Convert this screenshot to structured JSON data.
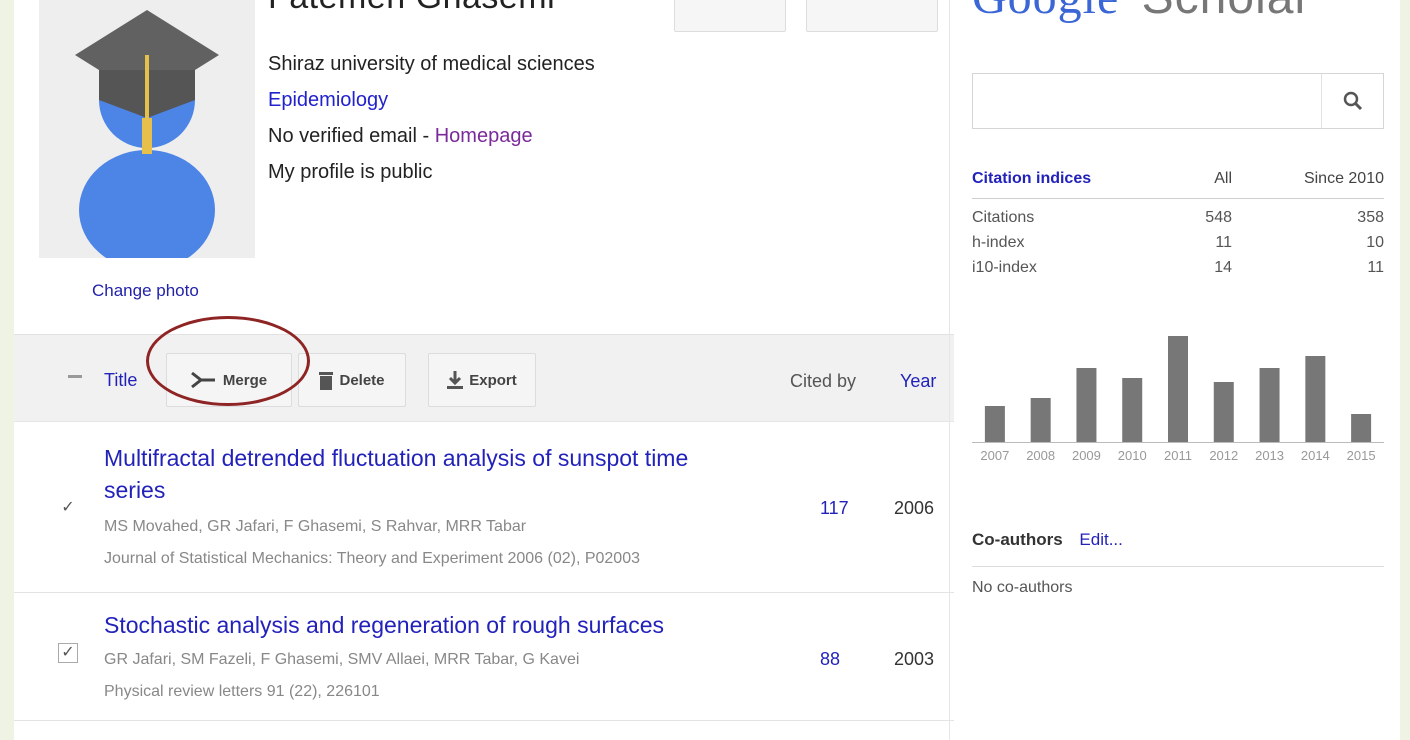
{
  "profile": {
    "name": "Fatemeh Ghasemi",
    "affiliation": "Shiraz university of medical sciences",
    "field": "Epidemiology",
    "email_text": "No verified email - ",
    "homepage": "Homepage",
    "visibility": "My profile is public",
    "change_photo": "Change photo"
  },
  "toolbar": {
    "title": "Title",
    "merge": "Merge",
    "delete": "Delete",
    "export": "Export",
    "cited_by": "Cited by",
    "year": "Year"
  },
  "articles": [
    {
      "title_line1": "Multifractal detrended fluctuation analysis of sunspot time",
      "title_line2": "series",
      "authors": "MS Movahed, GR Jafari, F Ghasemi, S Rahvar, MRR Tabar",
      "journal": "Journal of Statistical Mechanics: Theory and Experiment 2006 (02), P02003",
      "cited_by": "117",
      "year": "2006"
    },
    {
      "title_line1": "Stochastic analysis and regeneration of rough surfaces",
      "authors": "GR Jafari, SM Fazeli, F Ghasemi, SMV Allaei, MRR Tabar, G Kavei",
      "journal": "Physical review letters 91 (22), 226101",
      "cited_by": "88",
      "year": "2003"
    }
  ],
  "sidebar": {
    "logo_google": "Google",
    "logo_scholar": "Scholar",
    "citation_indices": {
      "header": "Citation indices",
      "all": "All",
      "since": "Since 2010",
      "rows": [
        {
          "label": "Citations",
          "all": "548",
          "since": "358"
        },
        {
          "label": "h-index",
          "all": "11",
          "since": "10"
        },
        {
          "label": "i10-index",
          "all": "14",
          "since": "11"
        }
      ]
    },
    "coauthors_title": "Co-authors",
    "coauthors_edit": "Edit...",
    "no_coauthors": "No co-authors"
  },
  "chart_data": {
    "type": "bar",
    "categories": [
      "2007",
      "2008",
      "2009",
      "2010",
      "2011",
      "2012",
      "2013",
      "2014",
      "2015"
    ],
    "values": [
      36,
      44,
      74,
      64,
      106,
      60,
      74,
      86,
      28
    ],
    "ylim": [
      0,
      110
    ],
    "grid": false,
    "color": "#777777"
  },
  "colors": {
    "link_blue": "#2222bb",
    "link_purple": "#7b2a9a",
    "annotation_circle": "#8e2424"
  }
}
